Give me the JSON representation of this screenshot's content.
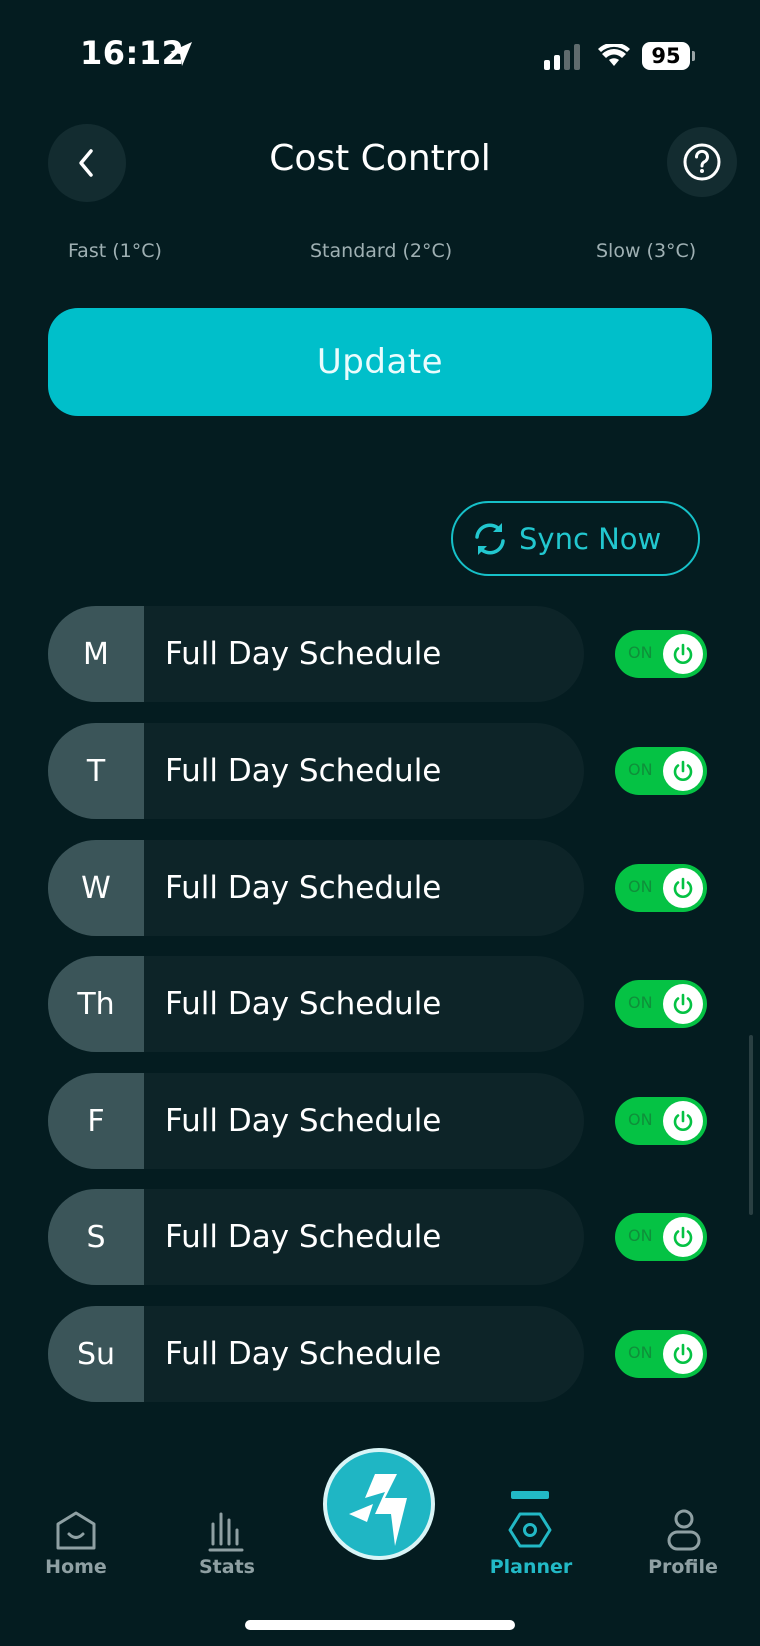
{
  "status_bar": {
    "time": "16:12",
    "battery": "95"
  },
  "header": {
    "title": "Cost Control"
  },
  "speed_options": [
    "Fast (1°C)",
    "Standard (2°C)",
    "Slow (3°C)"
  ],
  "update_label": "Update",
  "sync_label": "Sync Now",
  "schedules": [
    {
      "day": "M",
      "label": "Full Day Schedule",
      "toggle": "ON",
      "enabled": true
    },
    {
      "day": "T",
      "label": "Full Day Schedule",
      "toggle": "ON",
      "enabled": true
    },
    {
      "day": "W",
      "label": "Full Day Schedule",
      "toggle": "ON",
      "enabled": true
    },
    {
      "day": "Th",
      "label": "Full Day Schedule",
      "toggle": "ON",
      "enabled": true
    },
    {
      "day": "F",
      "label": "Full Day Schedule",
      "toggle": "ON",
      "enabled": true
    },
    {
      "day": "S",
      "label": "Full Day Schedule",
      "toggle": "ON",
      "enabled": true
    },
    {
      "day": "Su",
      "label": "Full Day Schedule",
      "toggle": "ON",
      "enabled": true
    }
  ],
  "nav": {
    "items": [
      {
        "label": "Home",
        "icon": "home-icon"
      },
      {
        "label": "Stats",
        "icon": "stats-icon"
      },
      {
        "label": "Planner",
        "icon": "planner-icon",
        "active": true
      },
      {
        "label": "Profile",
        "icon": "profile-icon"
      }
    ],
    "center_icon": "bolt-icon"
  },
  "colors": {
    "accent": "#00bfca",
    "toggle_on": "#05c244",
    "background": "#041c20"
  }
}
